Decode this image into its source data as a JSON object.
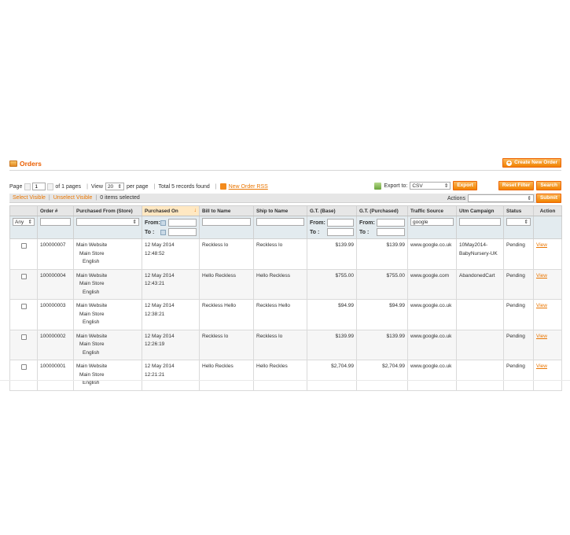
{
  "header": {
    "title": "Orders",
    "create_button": "Create New Order"
  },
  "pager": {
    "page_label": "Page",
    "page_value": "1",
    "of_pages": "of 1 pages",
    "view_label": "View",
    "per_page_value": "20",
    "per_page_label": "per page",
    "total": "Total 5 records found",
    "rss_link": "New Order RSS",
    "export_label": "Export to:",
    "export_format": "CSV",
    "export_button": "Export",
    "reset_button": "Reset Filter",
    "search_button": "Search"
  },
  "massaction": {
    "select_visible": "Select Visible",
    "unselect_visible": "Unselect Visible",
    "items_selected": "0 items selected",
    "actions_label": "Actions",
    "submit_button": "Submit"
  },
  "columns": [
    "Order #",
    "Purchased From (Store)",
    "Purchased On",
    "Bill to Name",
    "Ship to Name",
    "G.T. (Base)",
    "G.T. (Purchased)",
    "Traffic Source",
    "Utm Campaign",
    "Status",
    "Action"
  ],
  "filters": {
    "select_any": "Any",
    "from_label": "From:",
    "to_label": "To :",
    "traffic_value": "google"
  },
  "rows": [
    {
      "order": "100000007",
      "store": [
        "Main Website",
        "Main Store",
        "English"
      ],
      "date": "12 May 2014",
      "time": "12:48:52",
      "bill": "Reckless lo",
      "ship": "Reckless lo",
      "gt_base": "$139.99",
      "gt_purchased": "$139.99",
      "traffic": "www.google.co.uk",
      "utm": [
        "10May2014-",
        "BabyNursery-UK"
      ],
      "status": "Pending",
      "action": "View"
    },
    {
      "order": "100000004",
      "store": [
        "Main Website",
        "Main Store",
        "English"
      ],
      "date": "12 May 2014",
      "time": "12:43:21",
      "bill": "Hello Reckless",
      "ship": "Hello Reckless",
      "gt_base": "$755.00",
      "gt_purchased": "$755.00",
      "traffic": "www.google.com",
      "utm": [
        "AbandonedCart",
        ""
      ],
      "status": "Pending",
      "action": "View"
    },
    {
      "order": "100000003",
      "store": [
        "Main Website",
        "Main Store",
        "English"
      ],
      "date": "12 May 2014",
      "time": "12:38:21",
      "bill": "Reckless Hello",
      "ship": "Reckless Hello",
      "gt_base": "$94.99",
      "gt_purchased": "$94.99",
      "traffic": "www.google.co.uk",
      "utm": [
        "",
        ""
      ],
      "status": "Pending",
      "action": "View"
    },
    {
      "order": "100000002",
      "store": [
        "Main Website",
        "Main Store",
        "English"
      ],
      "date": "12 May 2014",
      "time": "12:26:19",
      "bill": "Reckless lo",
      "ship": "Reckless lo",
      "gt_base": "$139.99",
      "gt_purchased": "$139.99",
      "traffic": "www.google.co.uk",
      "utm": [
        "",
        ""
      ],
      "status": "Pending",
      "action": "View"
    },
    {
      "order": "100000001",
      "store": [
        "Main Website",
        "Main Store",
        "English"
      ],
      "date": "12 May 2014",
      "time": "12:21:21",
      "bill": "Hello Reckles",
      "ship": "Hello Reckles",
      "gt_base": "$2,704.99",
      "gt_purchased": "$2,704.99",
      "traffic": "www.google.co.uk",
      "utm": [
        "",
        ""
      ],
      "status": "Pending",
      "action": "View"
    }
  ],
  "colors": {
    "accent": "#eb5e00",
    "button": "#f18200",
    "header_bg": "#e6e6e6",
    "filter_bg": "#e3ebef"
  }
}
